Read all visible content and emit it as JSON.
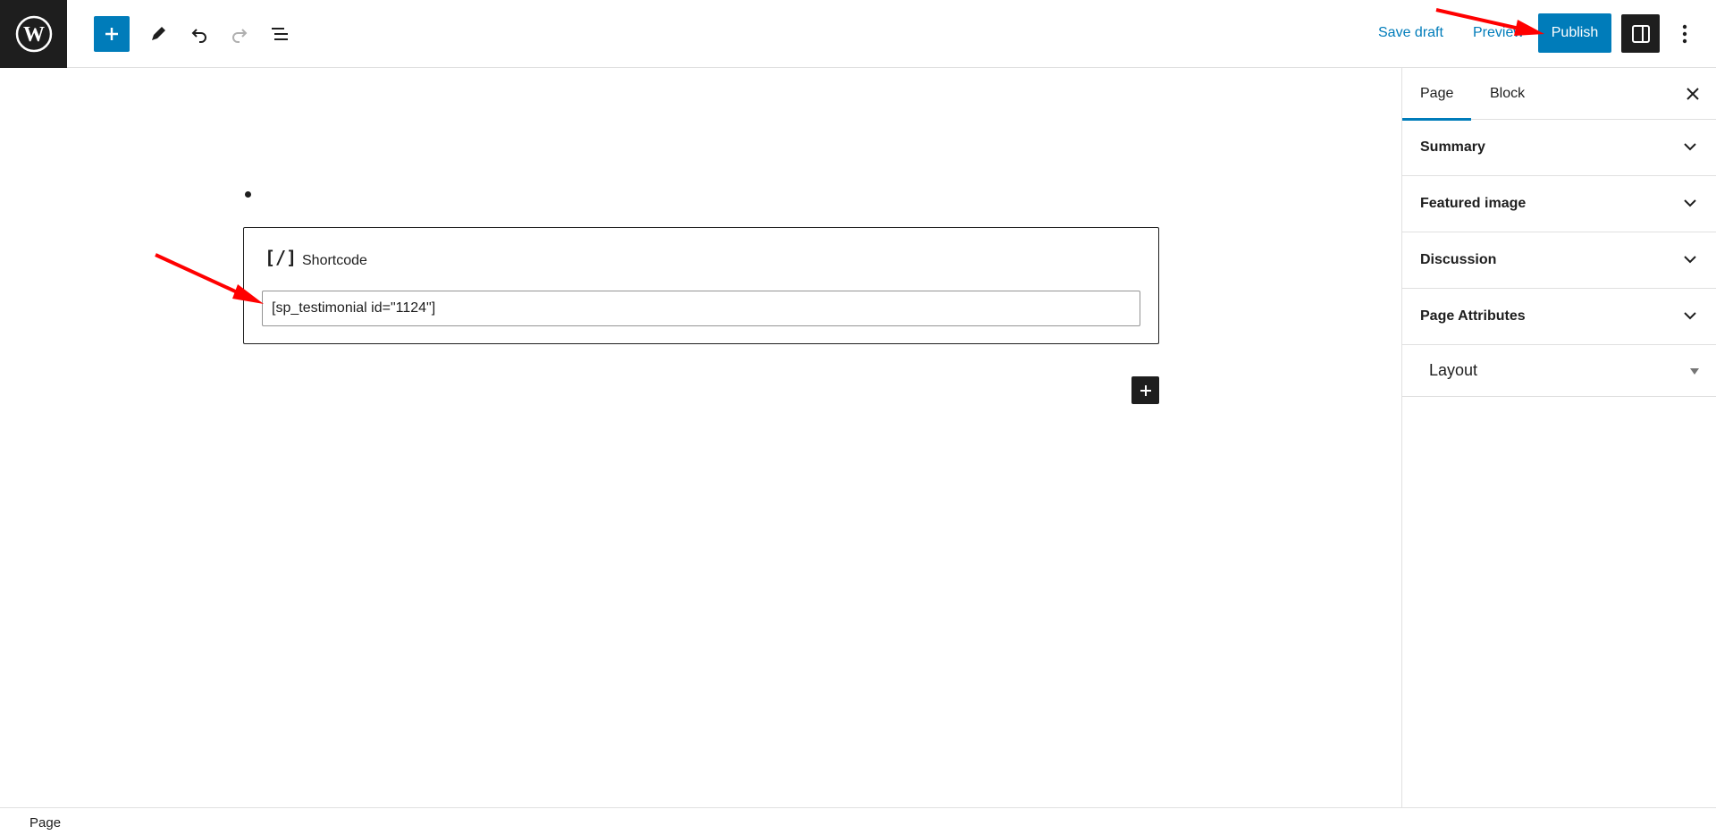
{
  "topbar": {
    "save_draft_label": "Save draft",
    "preview_label": "Preview",
    "publish_label": "Publish",
    "icons": [
      "wordpress-logo",
      "plus-icon",
      "pencil-icon",
      "undo-icon",
      "redo-icon",
      "list-view-icon",
      "sidebar-toggle-icon",
      "more-options-icon"
    ]
  },
  "editor": {
    "shortcode_block": {
      "icon_text": "[/]",
      "label": "Shortcode",
      "value": "[sp_testimonial id=\"1124\"]"
    }
  },
  "sidebar": {
    "tabs": [
      {
        "label": "Page",
        "active": true
      },
      {
        "label": "Block",
        "active": false
      }
    ],
    "panels": [
      {
        "label": "Summary"
      },
      {
        "label": "Featured image"
      },
      {
        "label": "Discussion"
      },
      {
        "label": "Page Attributes"
      },
      {
        "label": "Layout"
      }
    ]
  },
  "footer": {
    "breadcrumb": "Page"
  },
  "colors": {
    "accent": "#007cba",
    "dark": "#1e1e1e",
    "annotation": "#ff0000"
  }
}
